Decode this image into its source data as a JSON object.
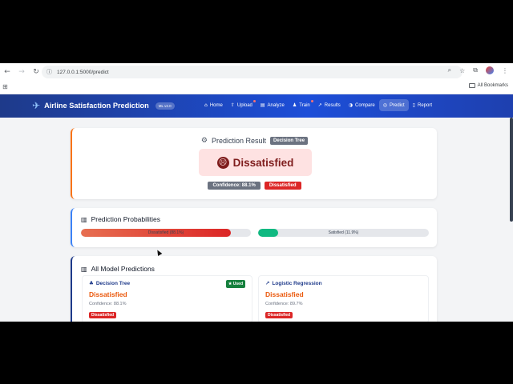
{
  "browser": {
    "url": "127.0.0.1:5000/predict",
    "bookmarks_label": "All Bookmarks"
  },
  "nav": {
    "brand": "Airline Satisfaction Prediction",
    "version": "ML v2.0",
    "links": [
      {
        "label": "Home",
        "icon": "home-icon"
      },
      {
        "label": "Upload",
        "icon": "upload-icon"
      },
      {
        "label": "Analyze",
        "icon": "chart-icon"
      },
      {
        "label": "Train",
        "icon": "person-icon"
      },
      {
        "label": "Results",
        "icon": "line-chart-icon"
      },
      {
        "label": "Compare",
        "icon": "compare-icon"
      },
      {
        "label": "Predict",
        "icon": "predict-icon"
      },
      {
        "label": "Report",
        "icon": "document-icon"
      }
    ]
  },
  "result": {
    "title": "Prediction Result",
    "model_tag": "Decision Tree",
    "outcome": "Dissatisfied",
    "confidence": "Confidence: 88.1%",
    "outcome_tag": "Dissatisfied"
  },
  "probabilities": {
    "title": "Prediction Probabilities",
    "dissatisfied_label": "Dissatisfied (88.1%)",
    "dissatisfied_fraction": 0.881,
    "satisfied_label": "Satisfied (11.9%)",
    "satisfied_fraction": 0.119,
    "colors": {
      "dissatisfied": "#dc2626",
      "satisfied": "#10b981"
    }
  },
  "all_models": {
    "title": "All Model Predictions",
    "models": [
      {
        "name": "Decision Tree",
        "badge": "Used",
        "prediction": "Dissatisfied",
        "confidence": "Confidence: 88.1%",
        "tag": "Dissatisfied"
      },
      {
        "name": "Logistic Regression",
        "badge": "",
        "prediction": "Dissatisfied",
        "confidence": "Confidence: 89.7%",
        "tag": "Dissatisfied"
      }
    ]
  }
}
